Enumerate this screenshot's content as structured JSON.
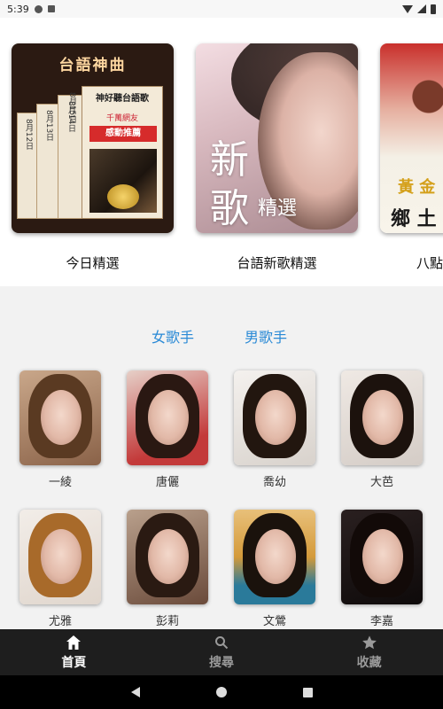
{
  "status_bar": {
    "time": "5:39"
  },
  "featured": [
    {
      "label": "今日精選",
      "art_title": "台語神曲",
      "box_title": "神好聽台語歌",
      "box_sub": "千萬網友",
      "box_badge": "感動推薦",
      "dates": [
        "8月15日",
        "8月14日",
        "8月13日",
        "8月12日"
      ]
    },
    {
      "label": "台語新歌精選",
      "art_big1": "新",
      "art_big2": "歌",
      "art_small": "精選"
    },
    {
      "label": "八點",
      "art_t1": "黃 金",
      "art_t2": "鄉 土 ん"
    }
  ],
  "tabs": [
    {
      "label": "女歌手"
    },
    {
      "label": "男歌手"
    }
  ],
  "singers": [
    {
      "name": "一綾"
    },
    {
      "name": "唐儷"
    },
    {
      "name": "喬幼"
    },
    {
      "name": "大芭"
    },
    {
      "name": "尤雅"
    },
    {
      "name": "彭莉"
    },
    {
      "name": "文鶯"
    },
    {
      "name": "李嘉"
    }
  ],
  "bottom_nav": [
    {
      "label": "首頁",
      "icon": "home-icon",
      "active": true
    },
    {
      "label": "搜尋",
      "icon": "search-icon",
      "active": false
    },
    {
      "label": "收藏",
      "icon": "star-icon",
      "active": false
    }
  ],
  "colors": {
    "tab_accent": "#2a8ad6",
    "nav_bg": "#1e1e1e",
    "nav_active": "#ffffff",
    "nav_inactive": "#9a9a9a"
  }
}
